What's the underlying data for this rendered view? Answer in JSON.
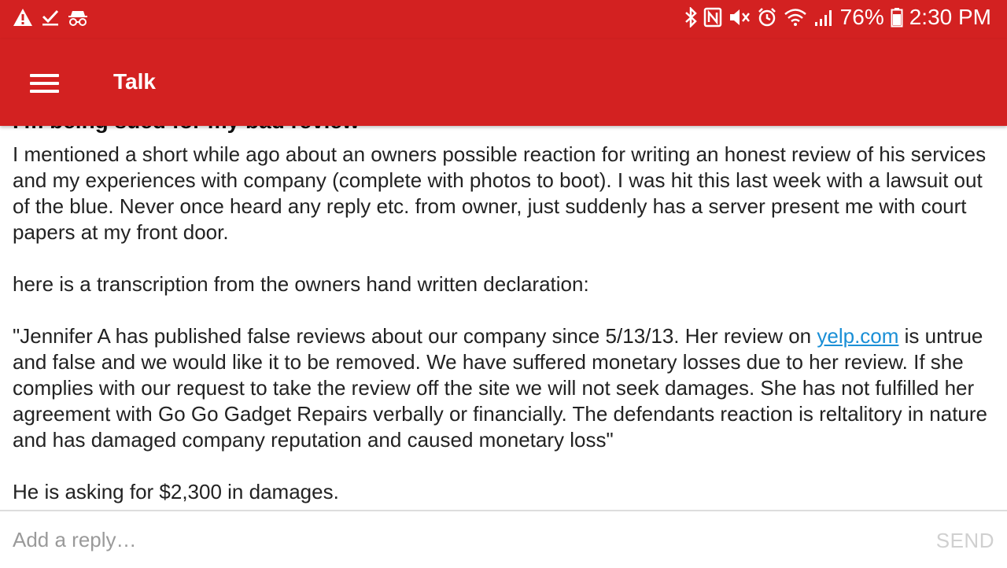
{
  "status_bar": {
    "battery_percent": "76%",
    "time": "2:30 PM",
    "left_icons": [
      "warning-icon",
      "checkbox-check-icon",
      "incognito-icon"
    ],
    "right_icons": [
      "bluetooth-icon",
      "nfc-icon",
      "mute-icon",
      "alarm-icon",
      "wifi-icon",
      "signal-icon",
      "battery-icon"
    ],
    "battery_level": 0.76
  },
  "app_bar": {
    "title": "Talk",
    "menu_icon": "hamburger-menu-icon",
    "background_color": "#d32121"
  },
  "post": {
    "title": "I'm being sued for my bad review",
    "paragraph_1": "I mentioned a short while ago about an owners possible reaction for writing an honest review of his services and my experiences with company (complete with photos to boot). I was hit this last week with a lawsuit out of the blue. Never once heard any reply etc. from owner, just suddenly has a server present me with court papers at my front door.",
    "paragraph_2": "here is a transcription from the owners hand written declaration:",
    "quote_before_link": "\"Jennifer A has published false reviews about our company since 5/13/13. Her review on ",
    "quote_link": "yelp.com",
    "quote_after_link": " is untrue and false and we would like it to be removed. We have suffered monetary losses due to her review. If she complies with our request to take the review off the site we will not seek damages. She has not fulfilled her agreement with Go Go Gadget Repairs verbally or financially. The defendants reaction is reltalitory in nature and has damaged company reputation and caused monetary loss\"",
    "paragraph_4": "He is asking for $2,300 in damages.",
    "link_color": "#1a8fd6"
  },
  "reply": {
    "placeholder": "Add a reply…",
    "value": "",
    "send_label": "SEND"
  }
}
